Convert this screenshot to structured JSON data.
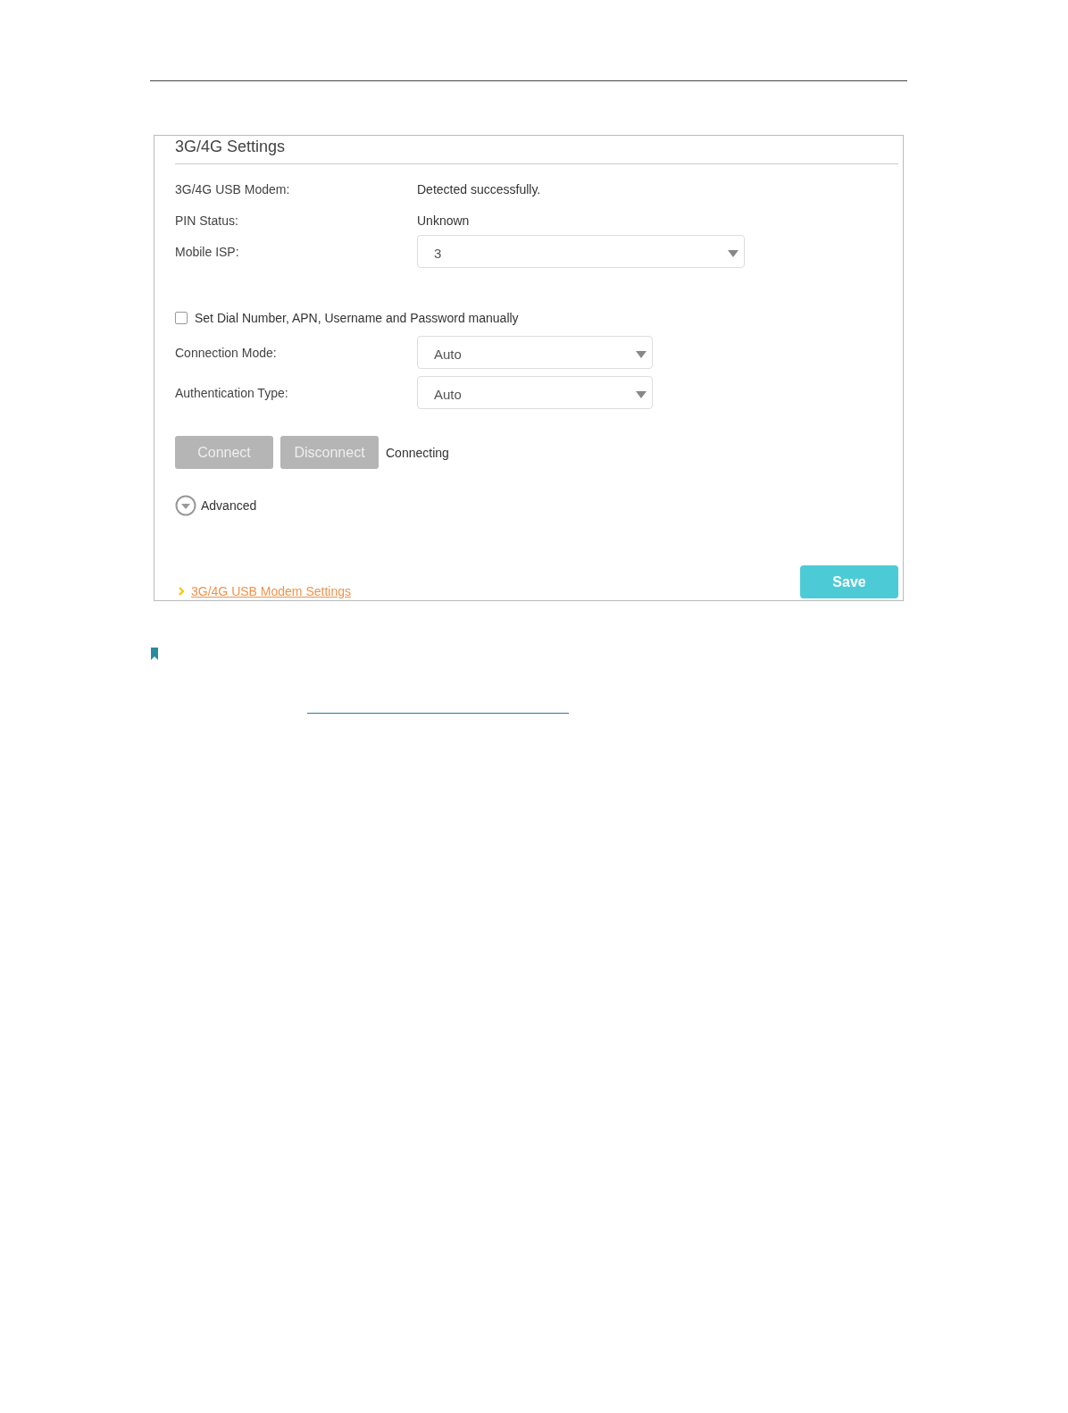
{
  "panel": {
    "title": "3G/4G Settings",
    "info_rows": [
      {
        "label": "3G/4G USB Modem:",
        "value": "Detected successfully."
      },
      {
        "label": "PIN Status:",
        "value": "Unknown"
      }
    ],
    "mobile_isp": {
      "label": "Mobile ISP:",
      "value": "3"
    },
    "manual_checkbox": {
      "label": "Set Dial Number, APN, Username and Password manually",
      "checked": false
    },
    "selects": [
      {
        "label": "Connection Mode:",
        "value": "Auto"
      },
      {
        "label": "Authentication Type:",
        "value": "Auto"
      }
    ],
    "buttons": [
      {
        "label": "Connect",
        "disabled": true
      },
      {
        "label": "Disconnect",
        "disabled": true
      }
    ],
    "connection_status": "Connecting",
    "advanced": {
      "label": "Advanced",
      "expanded": false
    },
    "link": "3G/4G USB Modem Settings",
    "save_button": "Save"
  }
}
